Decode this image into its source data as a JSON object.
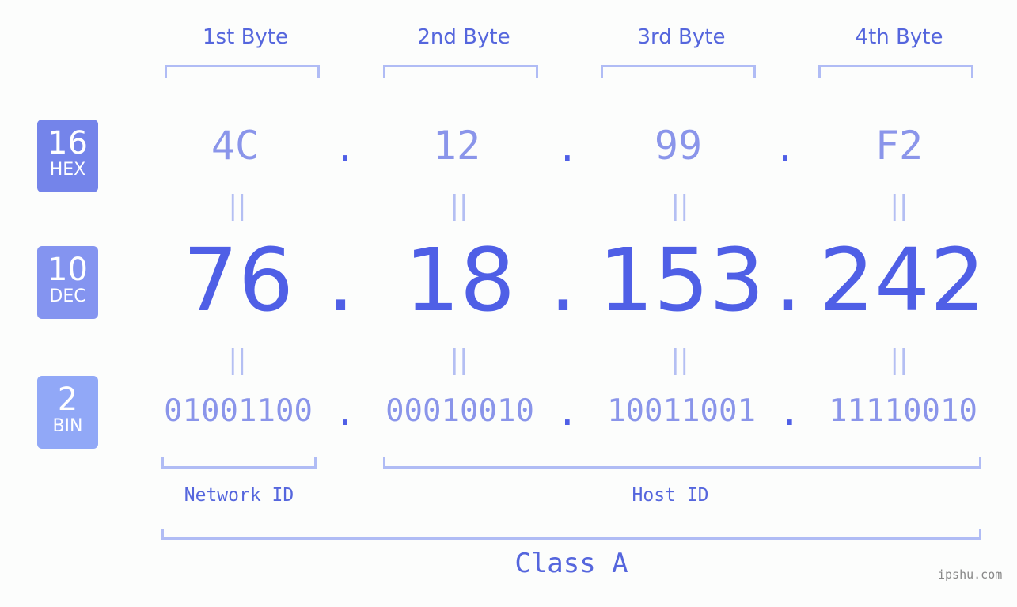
{
  "bytes": [
    {
      "label": "1st Byte",
      "hex": "4C",
      "dec": "76",
      "bin": "01001100"
    },
    {
      "label": "2nd Byte",
      "hex": "12",
      "dec": "18",
      "bin": "00010010"
    },
    {
      "label": "3rd Byte",
      "hex": "99",
      "dec": "153",
      "bin": "10011001"
    },
    {
      "label": "4th Byte",
      "hex": "F2",
      "dec": "242",
      "bin": "11110010"
    }
  ],
  "badges": {
    "hex": {
      "num": "16",
      "label": "HEX",
      "color": "#7484ea"
    },
    "dec": {
      "num": "10",
      "label": "DEC",
      "color": "#8494f0"
    },
    "bin": {
      "num": "2",
      "label": "BIN",
      "color": "#91a8f7"
    }
  },
  "separator": ".",
  "equals": "||",
  "network_id_label": "Network ID",
  "host_id_label": "Host ID",
  "class_label": "Class A",
  "watermark": "ipshu.com"
}
